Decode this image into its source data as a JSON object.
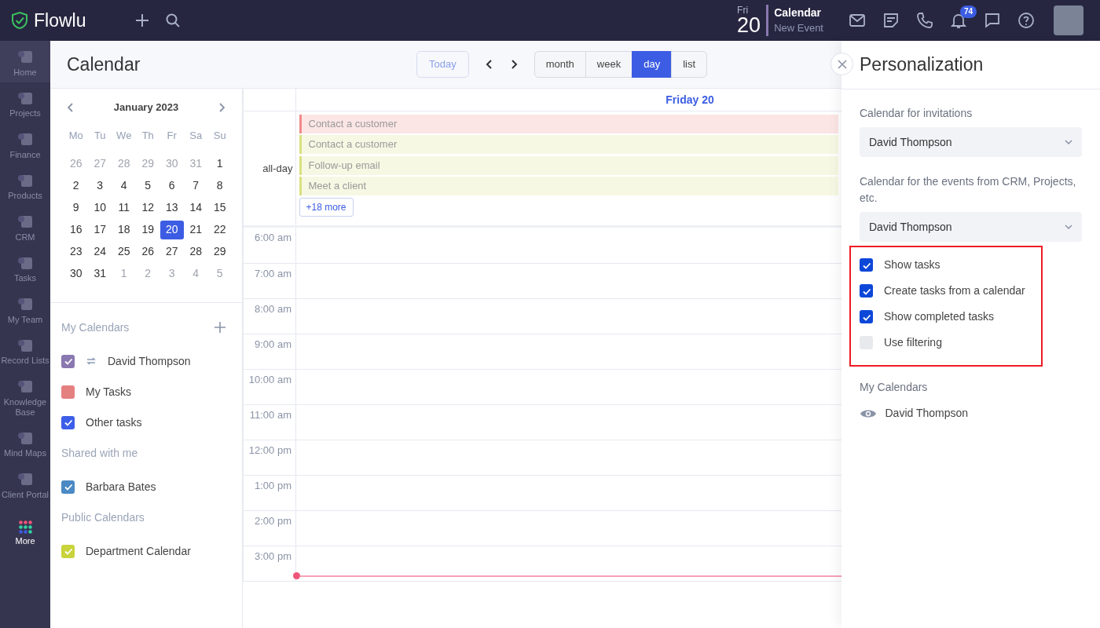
{
  "topbar": {
    "logo": "Flowlu",
    "date": {
      "weekday": "Fri",
      "day": "20"
    },
    "quick": {
      "title": "Calendar",
      "subtitle": "New Event"
    },
    "notifications": "74"
  },
  "sidebar": {
    "items": [
      {
        "label": "Home",
        "selected": true
      },
      {
        "label": "Projects",
        "selected": false
      },
      {
        "label": "Finance",
        "selected": false
      },
      {
        "label": "Products",
        "selected": false
      },
      {
        "label": "CRM",
        "selected": false
      },
      {
        "label": "Tasks",
        "selected": false
      },
      {
        "label": "My Team",
        "selected": false
      },
      {
        "label": "Record Lists",
        "selected": false
      },
      {
        "label": "Knowledge Base",
        "selected": false
      },
      {
        "label": "Mind Maps",
        "selected": false
      },
      {
        "label": "Client Portal",
        "selected": false
      },
      {
        "label": "More",
        "selected": false
      }
    ]
  },
  "page": {
    "title": "Calendar",
    "today": "Today",
    "views": [
      {
        "label": "month",
        "selected": false
      },
      {
        "label": "week",
        "selected": false
      },
      {
        "label": "day",
        "selected": true
      },
      {
        "label": "list",
        "selected": false
      }
    ]
  },
  "mini_calendar": {
    "month": "January 2023",
    "weekdays": [
      "Mo",
      "Tu",
      "We",
      "Th",
      "Fr",
      "Sa",
      "Su"
    ],
    "weeks": [
      [
        {
          "d": "26",
          "muted": true,
          "selected": false
        },
        {
          "d": "27",
          "muted": true,
          "selected": false
        },
        {
          "d": "28",
          "muted": true,
          "selected": false
        },
        {
          "d": "29",
          "muted": true,
          "selected": false
        },
        {
          "d": "30",
          "muted": true,
          "selected": false
        },
        {
          "d": "31",
          "muted": true,
          "selected": false
        },
        {
          "d": "1",
          "muted": false,
          "selected": false
        }
      ],
      [
        {
          "d": "2",
          "muted": false,
          "selected": false
        },
        {
          "d": "3",
          "muted": false,
          "selected": false
        },
        {
          "d": "4",
          "muted": false,
          "selected": false
        },
        {
          "d": "5",
          "muted": false,
          "selected": false
        },
        {
          "d": "6",
          "muted": false,
          "selected": false
        },
        {
          "d": "7",
          "muted": false,
          "selected": false
        },
        {
          "d": "8",
          "muted": false,
          "selected": false
        }
      ],
      [
        {
          "d": "9",
          "muted": false,
          "selected": false
        },
        {
          "d": "10",
          "muted": false,
          "selected": false
        },
        {
          "d": "11",
          "muted": false,
          "selected": false
        },
        {
          "d": "12",
          "muted": false,
          "selected": false
        },
        {
          "d": "13",
          "muted": false,
          "selected": false
        },
        {
          "d": "14",
          "muted": false,
          "selected": false
        },
        {
          "d": "15",
          "muted": false,
          "selected": false
        }
      ],
      [
        {
          "d": "16",
          "muted": false,
          "selected": false
        },
        {
          "d": "17",
          "muted": false,
          "selected": false
        },
        {
          "d": "18",
          "muted": false,
          "selected": false
        },
        {
          "d": "19",
          "muted": false,
          "selected": false
        },
        {
          "d": "20",
          "muted": false,
          "selected": true
        },
        {
          "d": "21",
          "muted": false,
          "selected": false
        },
        {
          "d": "22",
          "muted": false,
          "selected": false
        }
      ],
      [
        {
          "d": "23",
          "muted": false,
          "selected": false
        },
        {
          "d": "24",
          "muted": false,
          "selected": false
        },
        {
          "d": "25",
          "muted": false,
          "selected": false
        },
        {
          "d": "26",
          "muted": false,
          "selected": false
        },
        {
          "d": "27",
          "muted": false,
          "selected": false
        },
        {
          "d": "28",
          "muted": false,
          "selected": false
        },
        {
          "d": "29",
          "muted": false,
          "selected": false
        }
      ],
      [
        {
          "d": "30",
          "muted": false,
          "selected": false
        },
        {
          "d": "31",
          "muted": false,
          "selected": false
        },
        {
          "d": "1",
          "muted": true,
          "selected": false
        },
        {
          "d": "2",
          "muted": true,
          "selected": false
        },
        {
          "d": "3",
          "muted": true,
          "selected": false
        },
        {
          "d": "4",
          "muted": true,
          "selected": false
        },
        {
          "d": "5",
          "muted": true,
          "selected": false
        }
      ]
    ]
  },
  "calendar_groups": [
    {
      "heading": "My Calendars",
      "items": [
        {
          "label": "David Thompson",
          "color": "#8a78b0",
          "checked": true,
          "synced": true
        },
        {
          "label": "My Tasks",
          "color": "#e58080",
          "checked": false,
          "synced": false
        },
        {
          "label": "Other tasks",
          "color": "#3d5ee8",
          "checked": true,
          "synced": false
        }
      ]
    },
    {
      "heading": "Shared with me",
      "items": [
        {
          "label": "Barbara Bates",
          "color": "#4b8ac4",
          "checked": true,
          "synced": false
        }
      ]
    },
    {
      "heading": "Public Calendars",
      "items": [
        {
          "label": "Department Calendar",
          "color": "#c9d33b",
          "checked": true,
          "synced": false
        }
      ]
    }
  ],
  "day_view": {
    "header": "Friday 20",
    "allday_label": "all-day",
    "events": [
      {
        "title": "Contact a customer",
        "color": "#f08a8a"
      },
      {
        "title": "Contact a customer",
        "color": "#d9e07f"
      },
      {
        "title": "Follow-up email",
        "color": "#d9e07f"
      },
      {
        "title": "Meet a client",
        "color": "#d9e07f"
      }
    ],
    "more": "+18 more",
    "times": [
      "6:00 am",
      "7:00 am",
      "8:00 am",
      "9:00 am",
      "10:00 am",
      "11:00 am",
      "12:00 pm",
      "1:00 pm",
      "2:00 pm",
      "3:00 pm"
    ]
  },
  "panel": {
    "title": "Personalization",
    "fields": [
      {
        "label": "Calendar for invitations",
        "value": "David Thompson"
      },
      {
        "label": "Calendar for the events from CRM, Projects, etc.",
        "value": "David Thompson"
      }
    ],
    "options_highlighted": true,
    "options": [
      {
        "label": "Show tasks",
        "checked": true
      },
      {
        "label": "Create tasks from a calendar",
        "checked": true
      },
      {
        "label": "Show completed tasks",
        "checked": true
      },
      {
        "label": "Use filtering",
        "checked": false
      }
    ],
    "calendars_heading": "My Calendars",
    "calendars": [
      {
        "label": "David Thompson"
      }
    ]
  }
}
